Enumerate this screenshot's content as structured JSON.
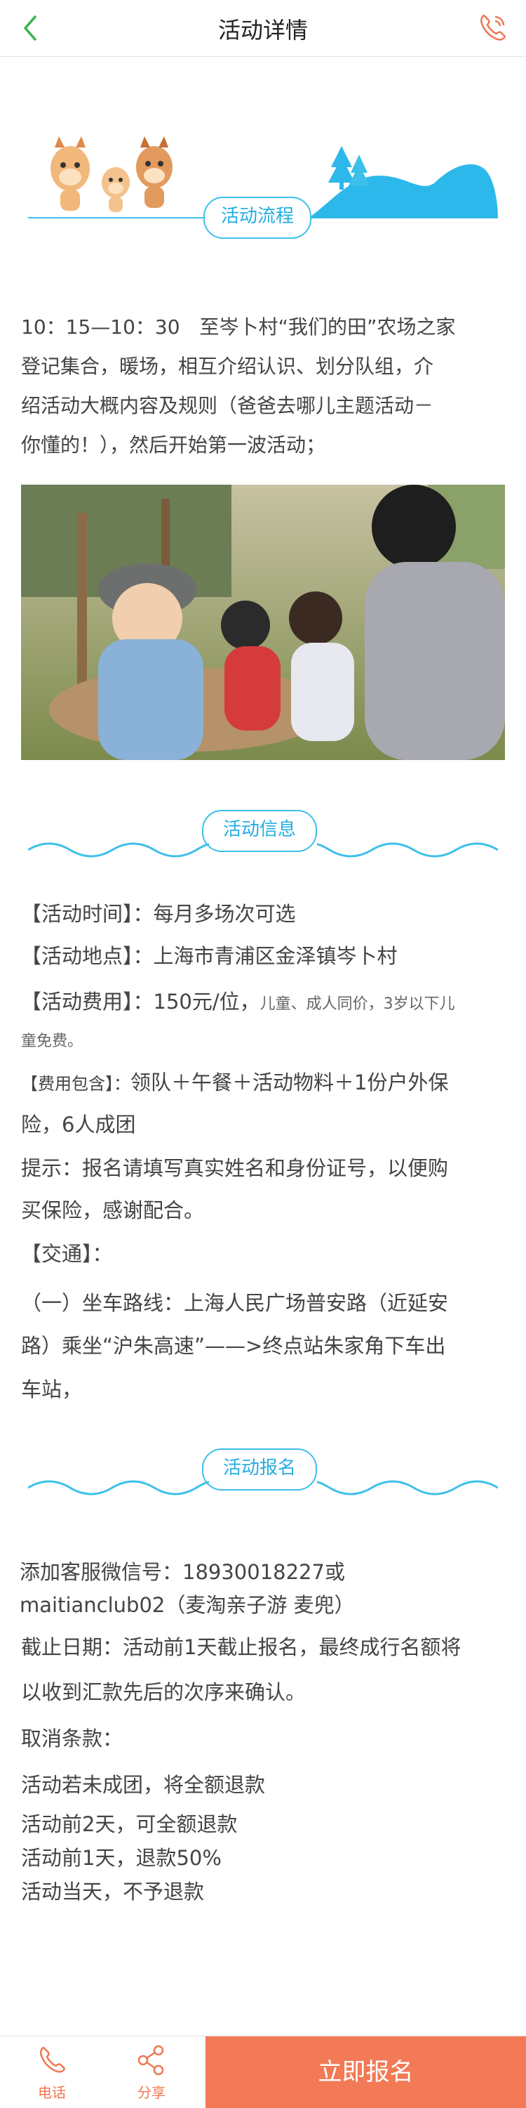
{
  "header": {
    "title": "活动详情"
  },
  "sections": {
    "flow_title": "活动流程",
    "info_title": "活动信息",
    "signup_title": "活动报名"
  },
  "flow": {
    "line1": "10：15—10：30　至岑卜村“我们的田”农场之家",
    "line2": "登记集合，暖场，相互介绍认识、划分队组，介",
    "line3": "绍活动大概内容及规则（爸爸去哪儿主题活动－",
    "line4": "你懂的！），然后开始第一波活动；"
  },
  "info": {
    "time_label": "【活动时间】：",
    "time_value": "每月多场次可选",
    "place_label": "【活动地点】：",
    "place_value": "上海市青浦区金泽镇岑卜村",
    "fee_label": "【活动费用】：",
    "fee_value": "150元/位，",
    "fee_note_a": "儿童、成人同价，3岁以下儿",
    "fee_note_b": "童免费。",
    "include_label": "【费用包含】：",
    "include_a": "领队＋午餐＋活动物料＋1份户外保",
    "include_b": "险，6人成团",
    "tip_a": "提示：报名请填写真实姓名和身份证号，以便购",
    "tip_b": "买保险，感谢配合。",
    "traffic_label": "【交通】：",
    "route_a": "（一）坐车路线：上海人民广场普安路（近延安",
    "route_b": "路）乘坐“沪朱高速”——>终点站朱家角下车出",
    "route_c": "车站，"
  },
  "signup": {
    "wechat_a": "添加客服微信号：18930018227或",
    "wechat_b": "maitianclub02（麦淘亲子游 麦兜）",
    "deadline_a": "截止日期：活动前1天截止报名，最终成行名额将",
    "deadline_b": "以收到汇款先后的次序来确认。",
    "cancel_title": "取消条款：",
    "cancel_1": "活动若未成团，将全额退款",
    "cancel_2": "活动前2天，可全额退款",
    "cancel_3": "活动前1天，退款50%",
    "cancel_4": "活动当天，不予退款"
  },
  "bottom": {
    "phone_label": "电话",
    "share_label": "分享",
    "signup_button": "立即报名"
  },
  "colors": {
    "accent": "#f27a56",
    "section_blue": "#23aee2",
    "wave_blue": "#3cc0ea",
    "back_green": "#3bb24a"
  },
  "icons": [
    "back-arrow-icon",
    "phone-icon",
    "share-icon"
  ]
}
